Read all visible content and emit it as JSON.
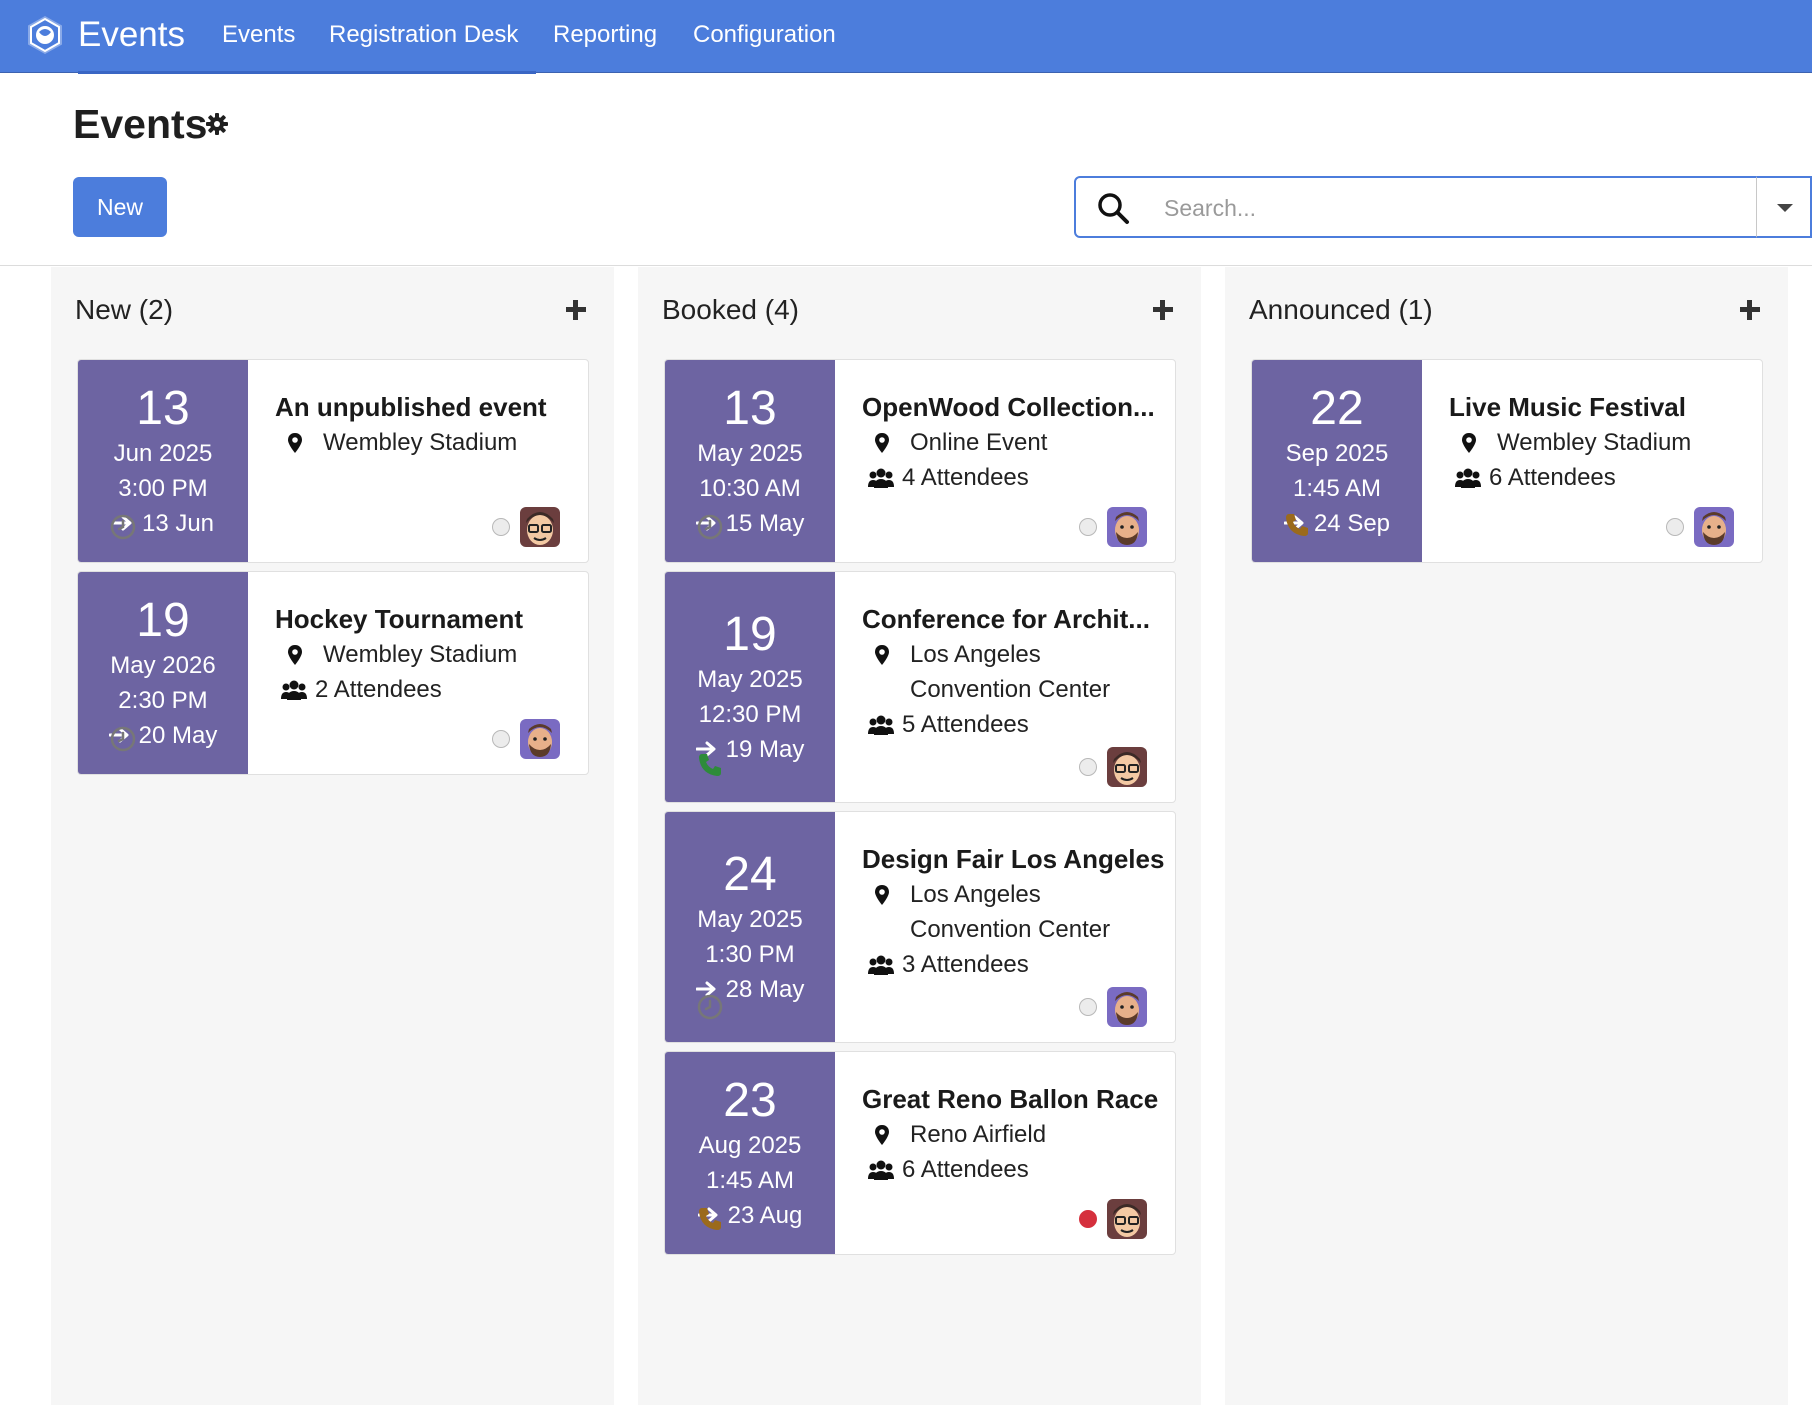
{
  "app": {
    "name": "Events",
    "menu": [
      "Events",
      "Registration Desk",
      "Reporting",
      "Configuration"
    ]
  },
  "control_panel": {
    "title": "Events",
    "new_button": "New",
    "search_placeholder": "Search..."
  },
  "colors": {
    "navbar": "#4c7ddc",
    "date_panel": "#6d64a2",
    "phone_green": "#2e8b3a",
    "phone_amber": "#9b6a1c",
    "status_red": "#d5303d"
  },
  "columns": [
    {
      "title": "New (2)",
      "cards": [
        {
          "day": "13",
          "month_year": "Jun 2025",
          "time": "3:00 PM",
          "end": "13 Jun",
          "title": "An unpublished event",
          "location": [
            "Wembley Stadium"
          ],
          "attendees": "",
          "activity_icon": "clock-icon",
          "status": "normal",
          "avatar": "glasses"
        },
        {
          "day": "19",
          "month_year": "May 2026",
          "time": "2:30 PM",
          "end": "20 May",
          "title": "Hockey Tournament",
          "location": [
            "Wembley Stadium"
          ],
          "attendees": "2 Attendees",
          "activity_icon": "clock-icon",
          "status": "normal",
          "avatar": "beard"
        }
      ]
    },
    {
      "title": "Booked (4)",
      "cards": [
        {
          "day": "13",
          "month_year": "May 2025",
          "time": "10:30 AM",
          "end": "15 May",
          "title": "OpenWood Collection...",
          "location": [
            "Online Event"
          ],
          "attendees": "4 Attendees",
          "activity_icon": "clock-icon",
          "status": "normal",
          "avatar": "beard"
        },
        {
          "day": "19",
          "month_year": "May 2025",
          "time": "12:30 PM",
          "end": "19 May",
          "title": "Conference for Archit...",
          "location": [
            "Los Angeles",
            "Convention Center"
          ],
          "attendees": "5 Attendees",
          "activity_icon": "phone-icon-green",
          "status": "normal",
          "avatar": "glasses"
        },
        {
          "day": "24",
          "month_year": "May 2025",
          "time": "1:30 PM",
          "end": "28 May",
          "title": "Design Fair Los Angeles",
          "location": [
            "Los Angeles",
            "Convention Center"
          ],
          "attendees": "3 Attendees",
          "activity_icon": "clock-icon",
          "status": "normal",
          "avatar": "beard"
        },
        {
          "day": "23",
          "month_year": "Aug 2025",
          "time": "1:45 AM",
          "end": "23 Aug",
          "title": "Great Reno Ballon Race",
          "location": [
            "Reno Airfield"
          ],
          "attendees": "6 Attendees",
          "activity_icon": "phone-icon-amber",
          "status": "blocked",
          "avatar": "glasses"
        }
      ]
    },
    {
      "title": "Announced (1)",
      "cards": [
        {
          "day": "22",
          "month_year": "Sep 2025",
          "time": "1:45 AM",
          "end": "24 Sep",
          "title": "Live Music Festival",
          "location": [
            "Wembley Stadium"
          ],
          "attendees": "6 Attendees",
          "activity_icon": "phone-icon-amber",
          "status": "normal",
          "avatar": "beard"
        }
      ]
    }
  ]
}
